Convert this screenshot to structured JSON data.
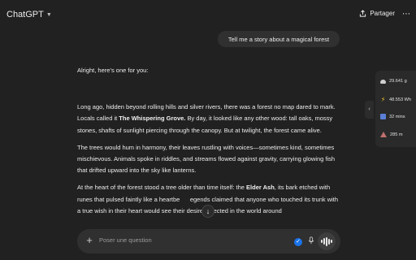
{
  "header": {
    "title": "ChatGPT",
    "share_label": "Partager",
    "more_glyph": "⋯"
  },
  "conversation": {
    "user_message": "Tell me a story about a magical forest",
    "assistant": {
      "intro": "Alright, here’s one for you:",
      "p1": [
        "Long ago, hidden beyond rolling hills and silver rivers, there was a forest no map dared to mark. Locals called it ",
        "The Whispering Grove.",
        " By day, it looked like any other wood: tall oaks, mossy stones, shafts of sunlight piercing through the canopy. But at twilight, the forest came alive."
      ],
      "p2": "The trees would hum in harmony, their leaves rustling with voices—sometimes kind, sometimes mischievous. Animals spoke in riddles, and streams flowed against gravity, carrying glowing fish that drifted upward into the sky like lanterns.",
      "p3": [
        "At the heart of the forest stood a tree older than time itself: the ",
        "Elder Ash",
        ", its bark etched with runes that pulsed faintly like a heartbe",
        "egends claimed that anyone who touched its trunk with a true wish in their heart would see their desire reflected in the world around"
      ]
    }
  },
  "composer": {
    "placeholder": "Poser une question"
  },
  "eco_panel": {
    "items": [
      {
        "icon": "cloud-icon",
        "value": "29.641 g"
      },
      {
        "icon": "lightning-icon",
        "value": "48.553 Wh"
      },
      {
        "icon": "timer-icon",
        "value": "32 mins"
      },
      {
        "icon": "mountain-icon",
        "value": "285 m"
      }
    ]
  },
  "colors": {
    "background": "#212121",
    "bubble": "#303030",
    "badge_blue": "#1a73e8"
  }
}
